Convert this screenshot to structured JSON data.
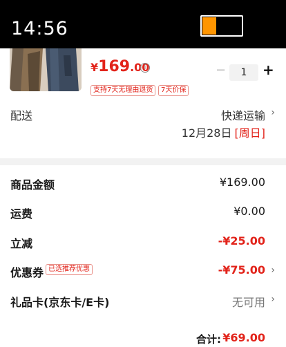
{
  "status_bar": {
    "time": "14:56",
    "battery_level": 0.35,
    "battery_color": "#ff9500"
  },
  "product": {
    "image": "jacket-thumbnail",
    "price": {
      "currency": "¥",
      "integer": "169",
      "decimal": ".00"
    },
    "quantity": "1",
    "tags": [
      "支持7天无理由退货",
      "7天价保"
    ]
  },
  "shipping": {
    "label": "配送",
    "method": "快递运输",
    "date": "12月28日",
    "weekday": "[周日]"
  },
  "summary": {
    "goods_amount": {
      "label": "商品金额",
      "value": "¥169.00"
    },
    "freight": {
      "label": "运费",
      "value": "¥0.00"
    },
    "discount": {
      "label": "立减",
      "value": "-¥25.00"
    },
    "coupon": {
      "label": "优惠券",
      "tag": "已选推荐优惠",
      "value": "-¥75.00"
    },
    "gift_card": {
      "label": "礼品卡(京东卡/E卡)",
      "value": "无可用"
    },
    "total": {
      "label": "合计:",
      "value": "¥69.00"
    }
  },
  "colors": {
    "accent": "#e2231a",
    "section_bg": "#f2f2f2"
  }
}
